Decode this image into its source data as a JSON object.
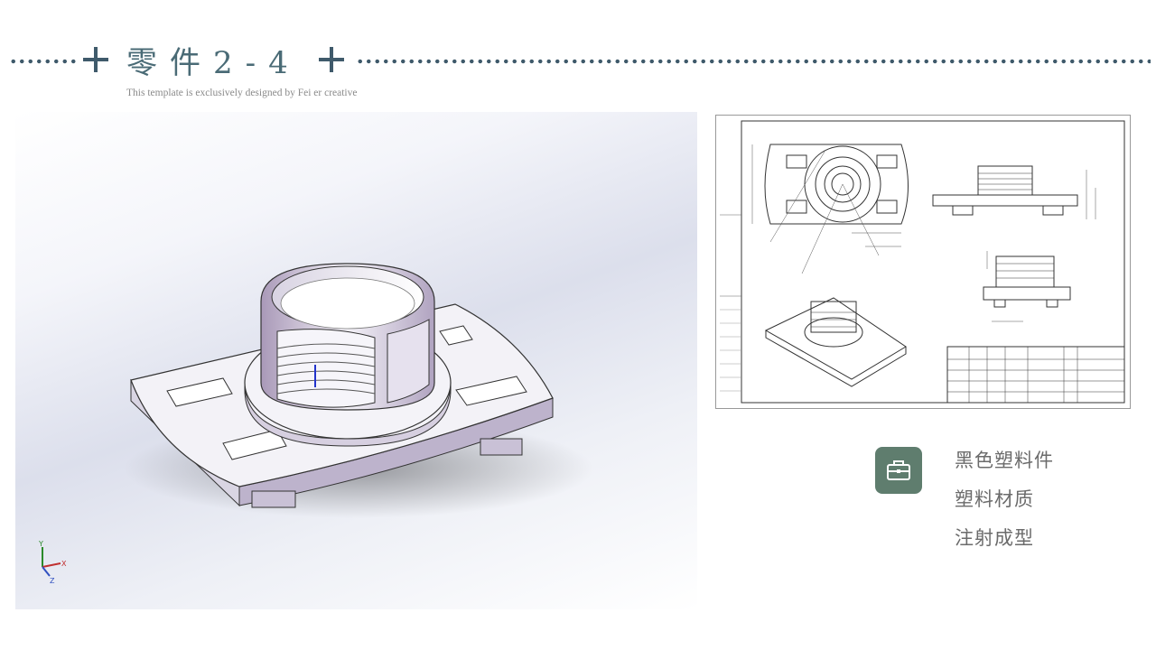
{
  "header": {
    "title": "零件2-4",
    "subtitle": "This template is exclusively  designed  by Fei er creative"
  },
  "axis_triad": {
    "x_label": "X",
    "y_label": "Y",
    "z_label": "Z"
  },
  "info": {
    "icon": "briefcase-icon",
    "lines": [
      "黑色塑料件",
      "塑料材质",
      "注射成型"
    ]
  },
  "colors": {
    "accent": "#3f5a6b",
    "icon_bg": "#5f7d6e",
    "text": "#6b6b6b"
  }
}
